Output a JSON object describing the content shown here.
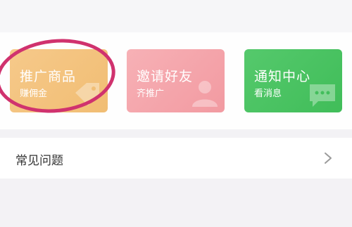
{
  "actions": {
    "promote": {
      "title": "推广商品",
      "subtitle": "赚佣金",
      "color": "#f2c07a",
      "icon": "tag-icon"
    },
    "invite": {
      "title": "邀请好友",
      "subtitle": "齐推广",
      "color": "#f5a8ae",
      "icon": "person-icon"
    },
    "notify": {
      "title": "通知中心",
      "subtitle": "看消息",
      "color": "#4cc464",
      "icon": "message-icon"
    }
  },
  "faq": {
    "label": "常见问题",
    "icon": "chevron-right-icon"
  },
  "annotation": {
    "color": "#d0326e"
  }
}
